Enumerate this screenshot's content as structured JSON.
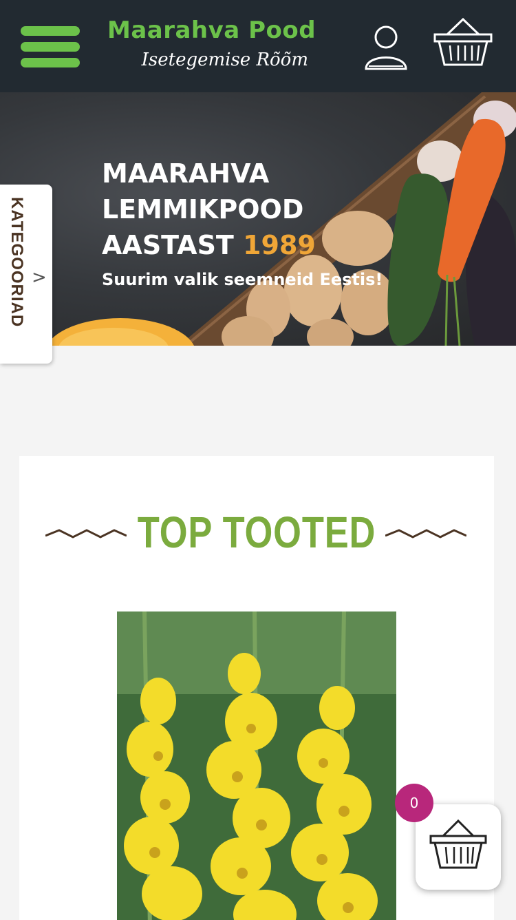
{
  "header": {
    "logo_title": "Maarahva Pood",
    "logo_subtitle": "Isetegemise Rõõm",
    "menu_icon": "hamburger-menu-icon",
    "account_icon": "user-icon",
    "cart_icon": "basket-icon"
  },
  "hero": {
    "title_line1": "MAARAHVA",
    "title_line2": "LEMMIKPOOD",
    "title_line3": "AASTAST",
    "year": "1989",
    "subtitle": "Suurim valik seemneid Eestis!"
  },
  "categories_tab": {
    "label": "KATEGOORIAD",
    "arrow": ">"
  },
  "top_products": {
    "title": "TOP TOOTED"
  },
  "floating_cart": {
    "count": "0",
    "icon": "basket-icon"
  },
  "colors": {
    "header_bg": "#222a31",
    "brand_green": "#6cc24a",
    "title_green": "#7bab3e",
    "accent_orange": "#f0a637",
    "badge_magenta": "#b8277b"
  }
}
